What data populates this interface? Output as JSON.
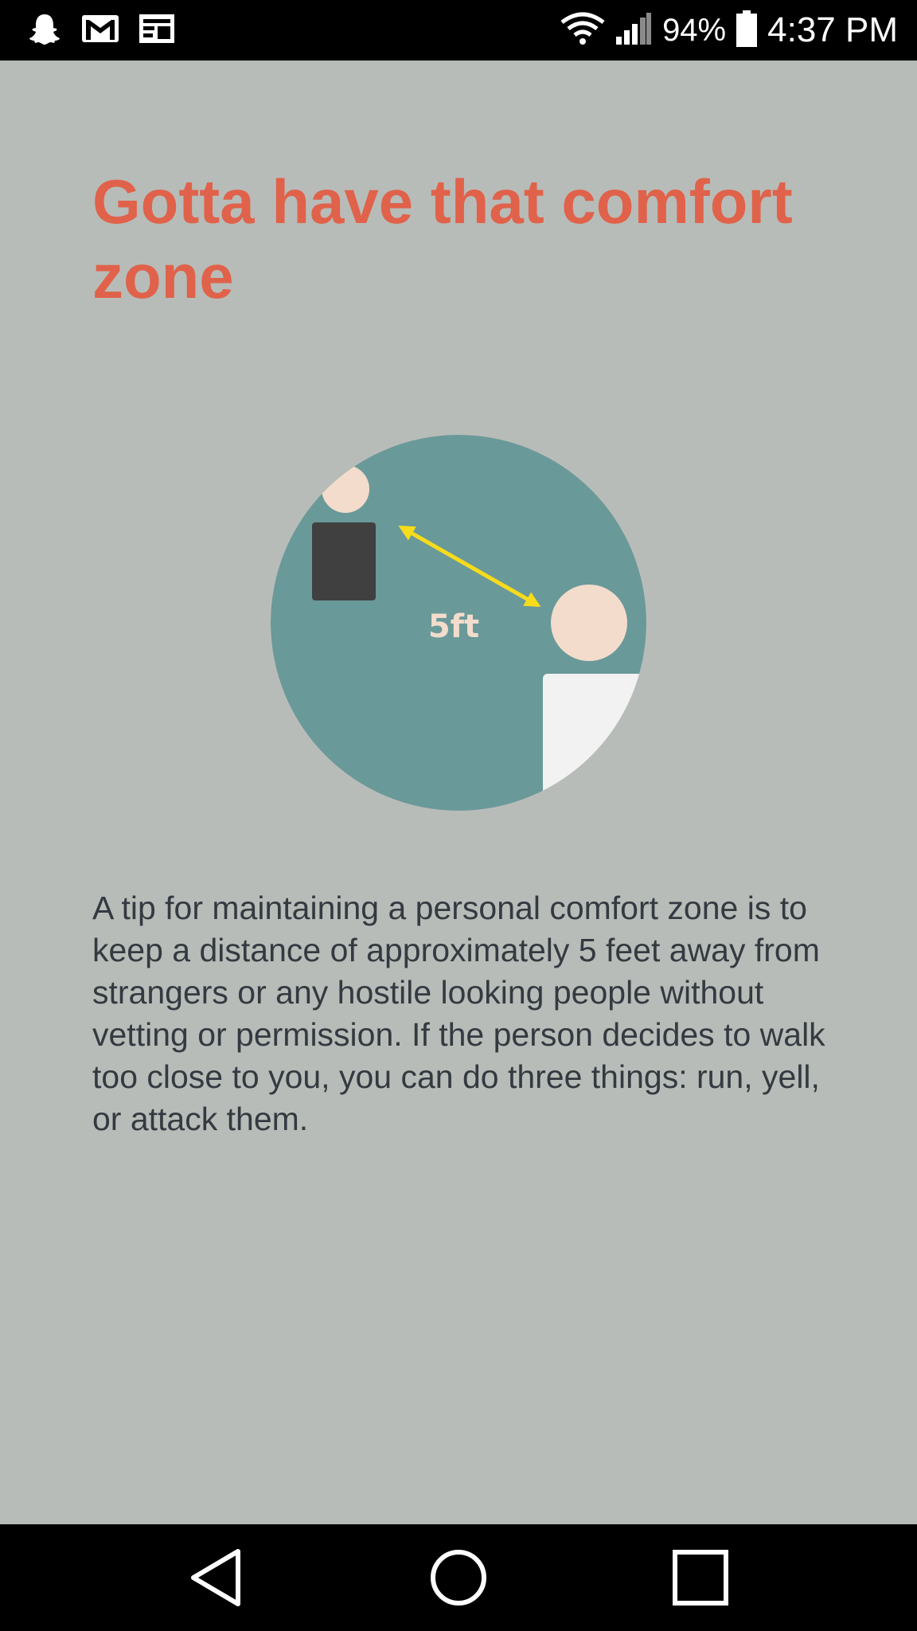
{
  "status_bar": {
    "left_icons": [
      "snapchat-icon",
      "gmail-icon",
      "messages-icon"
    ],
    "right_icons": [
      "wifi-icon",
      "cell-signal-icon",
      "battery-icon"
    ],
    "battery_percent": "94%",
    "time": "4:37 PM"
  },
  "page": {
    "title": "Gotta have that comfort zone",
    "illustration": {
      "distance_label": "5ft",
      "colors": {
        "circle": "#6a9999",
        "skin": "#f3dccc",
        "dark_body": "#404040",
        "light_body": "#f2f2f2",
        "arrow": "#f7dc1b",
        "label": "#f3dccc"
      }
    },
    "description": "A tip for maintaining a personal comfort zone is to keep a distance of approximately 5 feet away from strangers or any hostile looking people without vetting or permission. If the person decides to walk too close to you, you can do three things: run, yell, or attack them."
  },
  "nav_bar": {
    "buttons": [
      "back-icon",
      "home-icon",
      "recent-apps-icon"
    ]
  },
  "colors": {
    "background": "#b8bcb8",
    "title": "#e0624a",
    "body_text": "#333a40",
    "bars": "#000000"
  }
}
